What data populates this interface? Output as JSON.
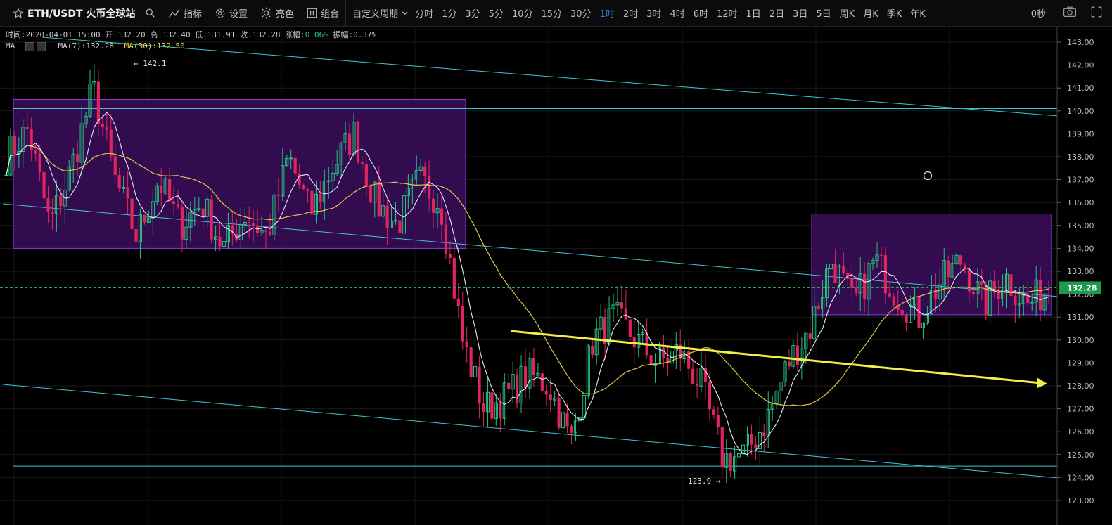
{
  "toolbar": {
    "symbol": "ETH/USDT 火币全球站",
    "indicator_label": "指标",
    "settings_label": "设置",
    "theme_label": "亮色",
    "combo_label": "组合",
    "custom_period_label": "自定义周期",
    "periods": [
      "分时",
      "1分",
      "3分",
      "5分",
      "10分",
      "15分",
      "30分",
      "1时",
      "2时",
      "3时",
      "4时",
      "6时",
      "12时",
      "1日",
      "2日",
      "3日",
      "5日",
      "周K",
      "月K",
      "季K",
      "年K"
    ],
    "active_period": "1时",
    "countdown": "0秒"
  },
  "info_bar": {
    "time": "时间:2020-04-01 15:00",
    "open": "开:132.20",
    "high": "高:132.40",
    "low": "低:131.91",
    "close": "收:132.28",
    "change_label": "涨幅:",
    "change_value": "0.06%",
    "amplitude": "振幅:0.37%",
    "ma_label": "MA",
    "ma7": "MA(7):132.28",
    "ma30": "MA(30):132.50"
  },
  "colors": {
    "up": "#26c281",
    "down": "#e0245e",
    "ma7": "#e8e8ff",
    "ma30": "#e6c84a",
    "trendline": "#3fc6d6",
    "box_fill": "#3c0e5e",
    "box_border": "#8a3bd8",
    "arrow": "#f4ee4a",
    "price_tag": "#1d9a4e",
    "active_period": "#2f7dff"
  },
  "chart_data": {
    "type": "candlestick",
    "symbol": "ETH/USDT",
    "interval": "1时",
    "y_ticks": [
      "143.00",
      "142.00",
      "141.00",
      "140.00",
      "139.00",
      "138.00",
      "137.00",
      "136.00",
      "135.00",
      "134.00",
      "133.00",
      "132.00",
      "131.00",
      "130.00",
      "129.00",
      "128.00",
      "127.00",
      "126.00",
      "125.00",
      "124.00",
      "123.00"
    ],
    "ylim": [
      122.3,
      143.55
    ],
    "current_price": "132.28",
    "annotations": {
      "high_label": "142.1",
      "low_label": "123.9"
    },
    "horizontal_lines": [
      140.1,
      124.5
    ],
    "zones": [
      {
        "top": 140.5,
        "bottom": 134.0
      },
      {
        "top": 135.5,
        "bottom": 131.1
      }
    ],
    "price_path_keypoints": [
      138.0,
      139.2,
      135.0,
      137.5,
      141.0,
      137.0,
      134.5,
      137.0,
      135.0,
      136.0,
      134.0,
      135.5,
      134.5,
      138.0,
      135.5,
      137.5,
      139.0,
      136.0,
      135.0,
      137.0,
      136.0,
      130.0,
      127.0,
      127.5,
      128.5,
      128.0,
      125.5,
      130.0,
      131.0,
      130.0,
      129.0,
      129.5,
      128.0,
      124.8,
      125.0,
      126.5,
      129.0,
      130.5,
      133.5,
      131.5,
      133.5,
      132.0,
      131.0,
      132.5,
      133.5,
      131.5,
      132.8,
      131.5,
      132.3
    ]
  }
}
